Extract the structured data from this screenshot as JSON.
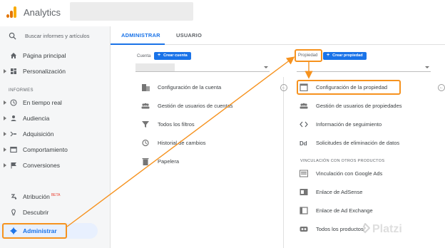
{
  "header": {
    "app_title": "Analytics",
    "logo_colors": [
      "#f9ab00",
      "#e37400",
      "#e37400"
    ]
  },
  "sidebar": {
    "search_placeholder": "Buscar informes y artículos",
    "section_reports": "INFORMES",
    "items": [
      {
        "label": "Página principal",
        "icon": "home-icon"
      },
      {
        "label": "Personalización",
        "icon": "dashboard-icon"
      },
      {
        "label": "En tiempo real",
        "icon": "clock-icon"
      },
      {
        "label": "Audiencia",
        "icon": "person-icon"
      },
      {
        "label": "Adquisición",
        "icon": "acquisition-icon"
      },
      {
        "label": "Comportamiento",
        "icon": "behavior-icon"
      },
      {
        "label": "Conversiones",
        "icon": "flag-icon"
      },
      {
        "label": "Atribución",
        "icon": "attribution-icon",
        "badge": "BETA"
      },
      {
        "label": "Descubrir",
        "icon": "lightbulb-icon"
      },
      {
        "label": "Administrar",
        "icon": "gear-icon"
      }
    ]
  },
  "tabs": [
    {
      "label": "ADMINISTRAR",
      "active": true
    },
    {
      "label": "USUARIO",
      "active": false
    }
  ],
  "account_column": {
    "label": "Cuenta",
    "create_button": "Crear cuenta",
    "items": [
      {
        "label": "Configuración de la cuenta",
        "icon": "building-icon"
      },
      {
        "label": "Gestión de usuarios de cuentas",
        "icon": "people-icon"
      },
      {
        "label": "Todos los filtros",
        "icon": "filter-icon"
      },
      {
        "label": "Historial de cambios",
        "icon": "history-icon"
      },
      {
        "label": "Papelera",
        "icon": "trash-icon"
      }
    ]
  },
  "property_column": {
    "label": "Propiedad",
    "create_button": "Crear propiedad",
    "items": [
      {
        "label": "Configuración de la propiedad",
        "icon": "settings-square-icon"
      },
      {
        "label": "Gestión de usuarios de propiedades",
        "icon": "people-icon"
      },
      {
        "label": "Información de seguimiento",
        "icon": "code-icon"
      },
      {
        "label": "Solicitudes de eliminación de datos",
        "icon": "dd-icon"
      }
    ],
    "linking_section": "VINCULACIÓN CON OTROS PRODUCTOS",
    "linking_items": [
      {
        "label": "Vinculación con Google Ads",
        "icon": "google-ads-icon"
      },
      {
        "label": "Enlace de AdSense",
        "icon": "adsense-icon"
      },
      {
        "label": "Enlace de Ad Exchange",
        "icon": "ad-exchange-icon"
      },
      {
        "label": "Todos los productos",
        "icon": "products-icon"
      }
    ]
  },
  "watermark": {
    "text": "Platzi"
  },
  "colors": {
    "accent": "#1a73e8",
    "highlight": "#f6921e",
    "sidebar_bg": "#f5f6f7"
  }
}
